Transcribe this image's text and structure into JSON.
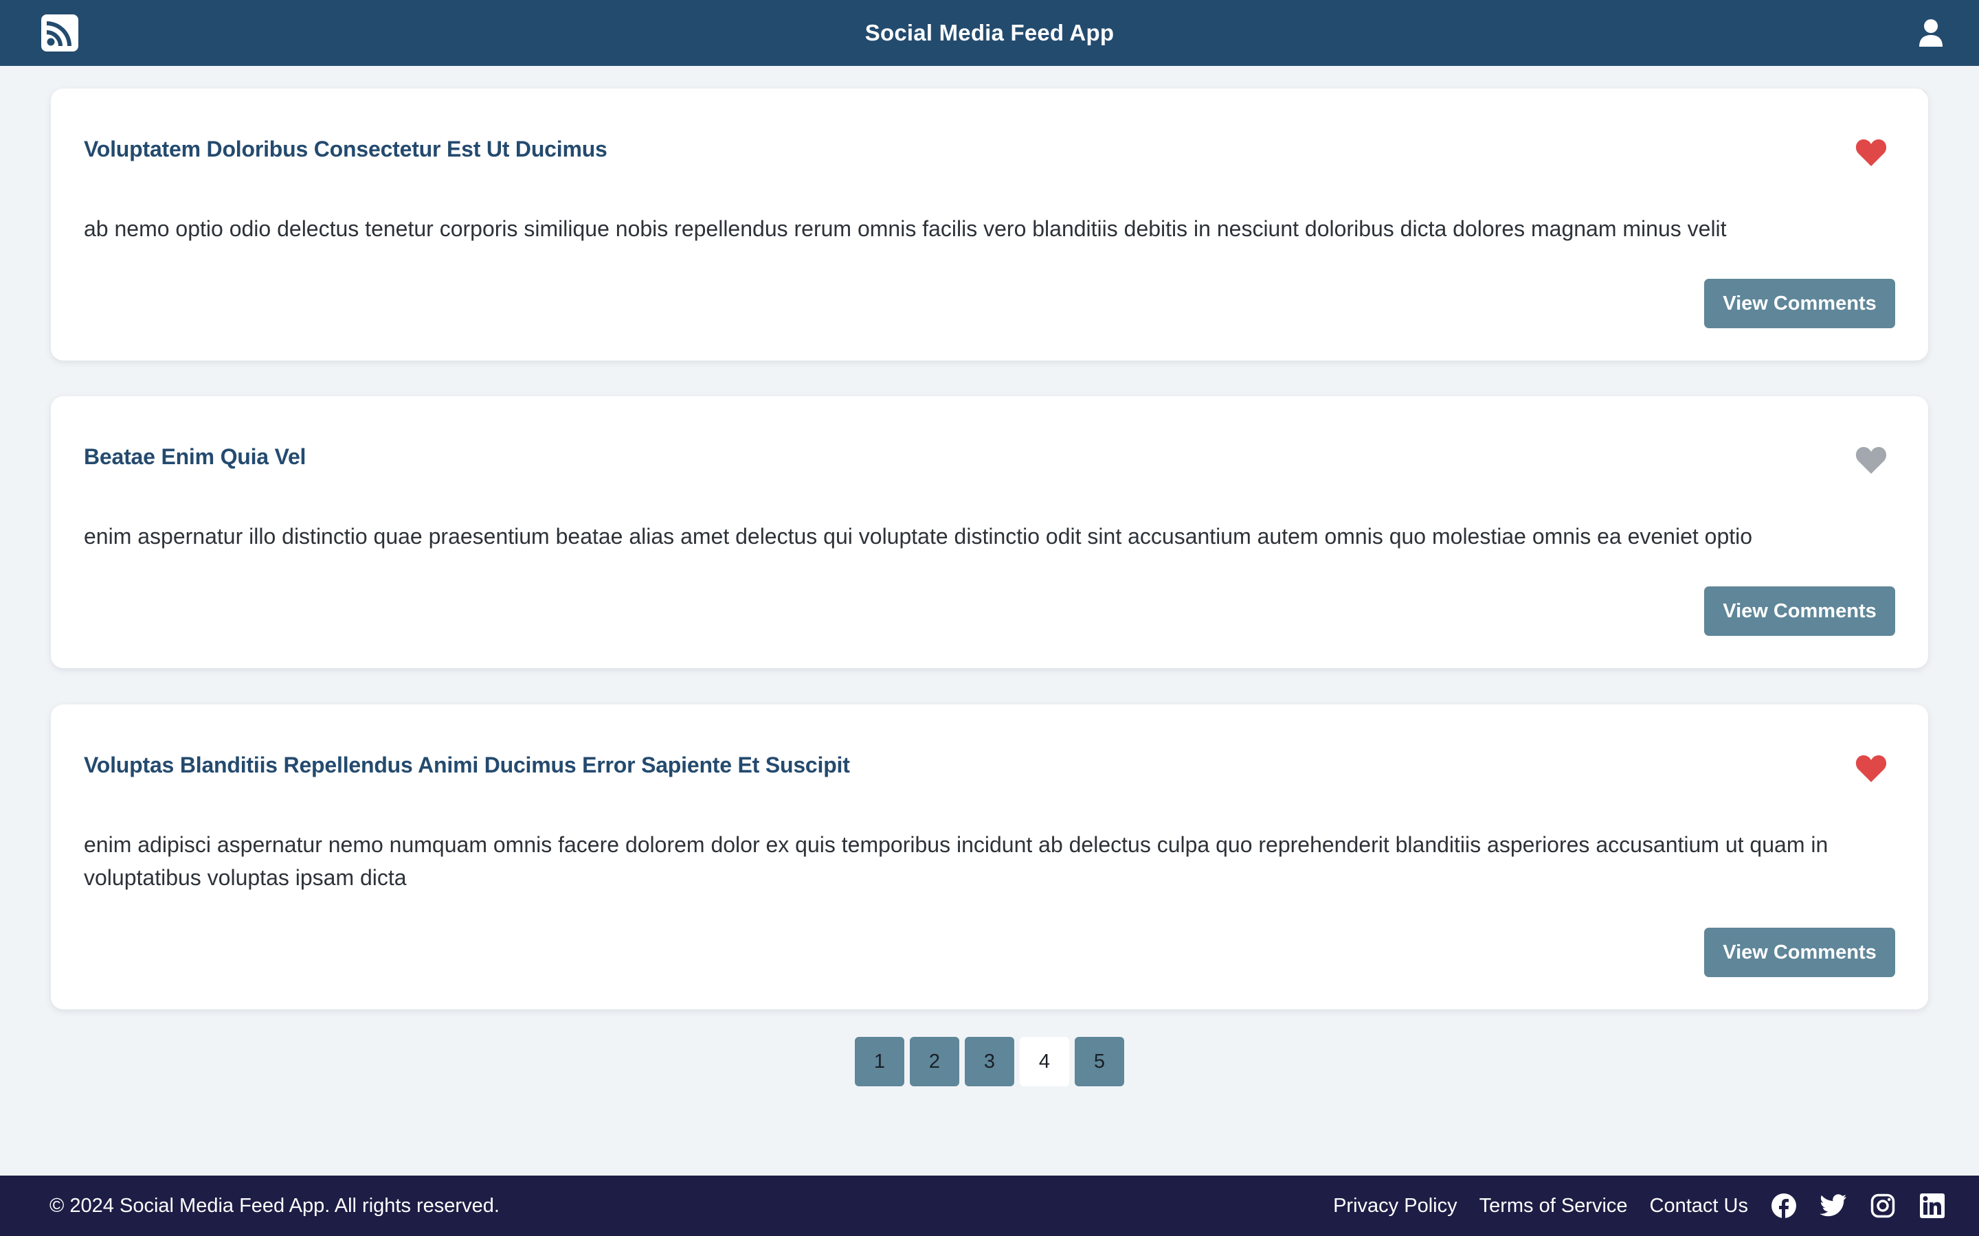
{
  "header": {
    "title": "Social Media Feed App",
    "logo_icon": "rss-icon",
    "user_icon": "user-icon",
    "background": "#234b6e"
  },
  "posts": [
    {
      "title": "Voluptatem Doloribus Consectetur Est Ut Ducimus",
      "body": "ab nemo optio odio delectus tenetur corporis similique nobis repellendus rerum omnis facilis vero blanditiis debitis in nesciunt doloribus dicta dolores magnam minus velit",
      "liked": true,
      "button_label": "View Comments"
    },
    {
      "title": "Beatae Enim Quia Vel",
      "body": "enim aspernatur illo distinctio quae praesentium beatae alias amet delectus qui voluptate distinctio odit sint accusantium autem omnis quo molestiae omnis ea eveniet optio",
      "liked": false,
      "button_label": "View Comments"
    },
    {
      "title": "Voluptas Blanditiis Repellendus Animi Ducimus Error Sapiente Et Suscipit",
      "body": "enim adipisci aspernatur nemo numquam omnis facere dolorem dolor ex quis temporibus incidunt ab delectus culpa quo reprehenderit blanditiis asperiores accusantium ut quam in voluptatibus voluptas ipsam dicta",
      "liked": true,
      "button_label": "View Comments"
    }
  ],
  "pagination": {
    "pages": [
      "1",
      "2",
      "3",
      "4",
      "5"
    ],
    "current": "4"
  },
  "footer": {
    "copyright": "© 2024 Social Media Feed App. All rights reserved.",
    "links": [
      "Privacy Policy",
      "Terms of Service",
      "Contact Us"
    ],
    "social_icons": [
      "facebook-icon",
      "twitter-icon",
      "instagram-icon",
      "linkedin-icon"
    ],
    "background": "#1d1d45"
  },
  "colors": {
    "heart_liked": "#e04848",
    "heart_unliked": "#a3a8ae",
    "button": "#5f8699",
    "title": "#244a6e"
  }
}
